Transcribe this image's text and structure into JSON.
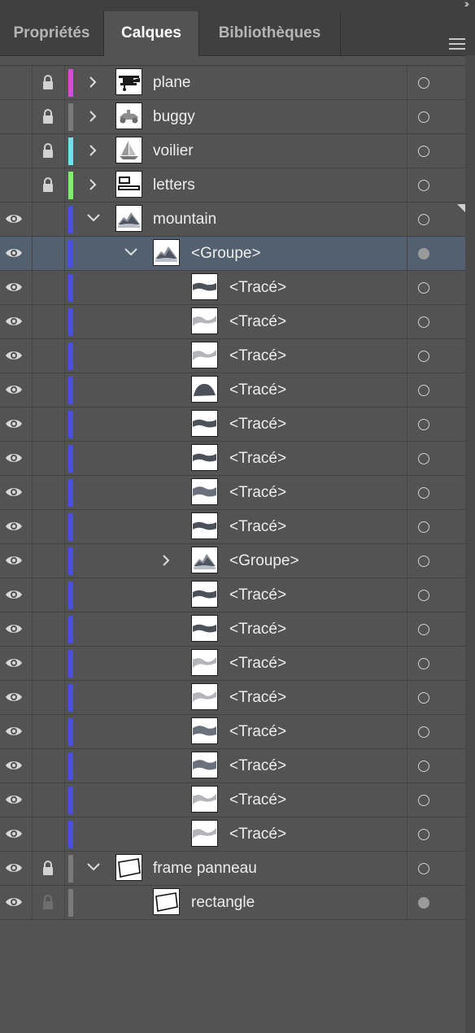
{
  "tabs": [
    {
      "label": "Propriétés",
      "active": false
    },
    {
      "label": "Calques",
      "active": true
    },
    {
      "label": "Bibliothèques",
      "active": false
    }
  ],
  "layers": [
    {
      "name": "plane",
      "color": "#d64cd8",
      "thumb": "plane",
      "chevron": "right",
      "depth": 0,
      "lock": "locked",
      "eye": false,
      "target": "empty",
      "selected": false
    },
    {
      "name": "buggy",
      "color": "#7a7a7a",
      "thumb": "buggy",
      "chevron": "right",
      "depth": 0,
      "lock": "locked",
      "eye": false,
      "target": "empty",
      "selected": false
    },
    {
      "name": "voilier",
      "color": "#6fe3ea",
      "thumb": "boat",
      "chevron": "right",
      "depth": 0,
      "lock": "locked",
      "eye": false,
      "target": "empty",
      "selected": false
    },
    {
      "name": "letters",
      "color": "#7ff06b",
      "thumb": "letters",
      "chevron": "right",
      "depth": 0,
      "lock": "locked",
      "eye": false,
      "target": "empty",
      "selected": false
    },
    {
      "name": "mountain",
      "color": "#4b4fe0",
      "thumb": "mountain",
      "chevron": "down",
      "depth": 0,
      "lock": "none",
      "eye": true,
      "target": "empty",
      "selected": false
    },
    {
      "name": "<Groupe>",
      "color": "#4b4fe0",
      "thumb": "mountain",
      "chevron": "down",
      "depth": 1,
      "lock": "none",
      "eye": true,
      "target": "filled",
      "selected": true
    },
    {
      "name": "<Tracé>",
      "color": "#4b4fe0",
      "thumb": "wave-dark",
      "chevron": "none",
      "depth": 2,
      "lock": "none",
      "eye": true,
      "target": "empty",
      "selected": false
    },
    {
      "name": "<Tracé>",
      "color": "#4b4fe0",
      "thumb": "wave-light",
      "chevron": "none",
      "depth": 2,
      "lock": "none",
      "eye": true,
      "target": "empty",
      "selected": false
    },
    {
      "name": "<Tracé>",
      "color": "#4b4fe0",
      "thumb": "wave-light",
      "chevron": "none",
      "depth": 2,
      "lock": "none",
      "eye": true,
      "target": "empty",
      "selected": false
    },
    {
      "name": "<Tracé>",
      "color": "#4b4fe0",
      "thumb": "hill",
      "chevron": "none",
      "depth": 2,
      "lock": "none",
      "eye": true,
      "target": "empty",
      "selected": false
    },
    {
      "name": "<Tracé>",
      "color": "#4b4fe0",
      "thumb": "wave-dark",
      "chevron": "none",
      "depth": 2,
      "lock": "none",
      "eye": true,
      "target": "empty",
      "selected": false
    },
    {
      "name": "<Tracé>",
      "color": "#4b4fe0",
      "thumb": "wave-dark",
      "chevron": "none",
      "depth": 2,
      "lock": "none",
      "eye": true,
      "target": "empty",
      "selected": false
    },
    {
      "name": "<Tracé>",
      "color": "#4b4fe0",
      "thumb": "wave-mid",
      "chevron": "none",
      "depth": 2,
      "lock": "none",
      "eye": true,
      "target": "empty",
      "selected": false
    },
    {
      "name": "<Tracé>",
      "color": "#4b4fe0",
      "thumb": "wave-dark",
      "chevron": "none",
      "depth": 2,
      "lock": "none",
      "eye": true,
      "target": "empty",
      "selected": false
    },
    {
      "name": "<Groupe>",
      "color": "#4b4fe0",
      "thumb": "mountain",
      "chevron": "right",
      "depth": 2,
      "lock": "none",
      "eye": true,
      "target": "empty",
      "selected": false
    },
    {
      "name": "<Tracé>",
      "color": "#4b4fe0",
      "thumb": "wave-dark",
      "chevron": "none",
      "depth": 2,
      "lock": "none",
      "eye": true,
      "target": "empty",
      "selected": false
    },
    {
      "name": "<Tracé>",
      "color": "#4b4fe0",
      "thumb": "wave-dark",
      "chevron": "none",
      "depth": 2,
      "lock": "none",
      "eye": true,
      "target": "empty",
      "selected": false
    },
    {
      "name": "<Tracé>",
      "color": "#4b4fe0",
      "thumb": "wave-light",
      "chevron": "none",
      "depth": 2,
      "lock": "none",
      "eye": true,
      "target": "empty",
      "selected": false
    },
    {
      "name": "<Tracé>",
      "color": "#4b4fe0",
      "thumb": "wave-light",
      "chevron": "none",
      "depth": 2,
      "lock": "none",
      "eye": true,
      "target": "empty",
      "selected": false
    },
    {
      "name": "<Tracé>",
      "color": "#4b4fe0",
      "thumb": "wave-mid",
      "chevron": "none",
      "depth": 2,
      "lock": "none",
      "eye": true,
      "target": "empty",
      "selected": false
    },
    {
      "name": "<Tracé>",
      "color": "#4b4fe0",
      "thumb": "wave-mid",
      "chevron": "none",
      "depth": 2,
      "lock": "none",
      "eye": true,
      "target": "empty",
      "selected": false
    },
    {
      "name": "<Tracé>",
      "color": "#4b4fe0",
      "thumb": "wave-light",
      "chevron": "none",
      "depth": 2,
      "lock": "none",
      "eye": true,
      "target": "empty",
      "selected": false
    },
    {
      "name": "<Tracé>",
      "color": "#4b4fe0",
      "thumb": "wave-light",
      "chevron": "none",
      "depth": 2,
      "lock": "none",
      "eye": true,
      "target": "empty",
      "selected": false
    },
    {
      "name": "frame panneau",
      "color": "#7a7a7a",
      "thumb": "frame",
      "chevron": "down",
      "depth": 0,
      "lock": "locked",
      "eye": true,
      "target": "empty",
      "selected": false
    },
    {
      "name": "rectangle",
      "color": "#7a7a7a",
      "thumb": "frame",
      "chevron": "none",
      "depth": 1,
      "lock": "dim",
      "eye": true,
      "target": "filled",
      "selected": false
    }
  ]
}
